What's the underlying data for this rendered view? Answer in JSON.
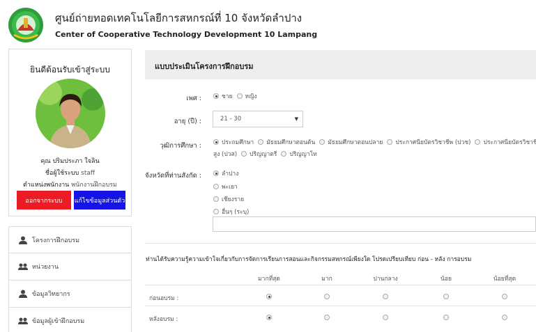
{
  "header": {
    "title_th": "ศูนย์ถ่ายทอดเทคโนโลยีการสหกรณ์ที่ 10 จังหวัดลำปาง",
    "title_en": "Center of Cooperative Technology Development 10 Lampang",
    "logo_icon": "cooperative-logo-icon"
  },
  "profile": {
    "welcome": "ยินดีต้อนรับเข้าสู่ระบบ",
    "name_prefix": "คุณ",
    "name": "ปริมประภา ใจลิน",
    "username_label": "ชื่อผู้ใช้ระบบ",
    "username": "staff",
    "position_label": "ตำแหน่งพนักงาน",
    "position": "พนักงานฝึกอบรม",
    "logout_label": "ออกจากระบบ",
    "edit_label": "แก้ไขข้อมูลส่วนตัว",
    "colors": {
      "logout": "#ed1c24",
      "edit": "#1414e6"
    }
  },
  "menu": {
    "items": [
      {
        "label": "โครงการฝึกอบรม",
        "icon": "user-icon"
      },
      {
        "label": "หน่วยงาน",
        "icon": "group-icon"
      },
      {
        "label": "ข้อมูลวิทยากร",
        "icon": "user-icon"
      },
      {
        "label": "ข้อมูลผู้เข้าฝึกอบรม",
        "icon": "group-icon"
      }
    ]
  },
  "form": {
    "title": "แบบประเมินโครงการฝึกอบรม",
    "gender": {
      "label": "เพศ :",
      "options": [
        "ชาย",
        "หญิง"
      ],
      "selected": "ชาย"
    },
    "age": {
      "label": "อายุ (ปี) :",
      "value": "21 - 30"
    },
    "education": {
      "label": "วุฒิการศึกษา :",
      "options": [
        "ประถมศึกษา",
        "มัธยมศึกษาตอนต้น",
        "มัธยมศึกษาตอนปลาย",
        "ประกาศนียบัตรวิชาชีพ (ปวช)",
        "ประกาศนียบัตรวิชาชีพชั้นสูง (ปวส)",
        "ปริญญาตรี",
        "ปริญญาโท"
      ],
      "line1": [
        "ประถมศึกษา",
        "มัธยมศึกษาตอนต้น",
        "มัธยมศึกษาตอนปลาย",
        "ประกาศนียบัตรวิชาชีพ (ปวช)",
        "ประกาศนียบัตรวิชาชีพชั้น"
      ],
      "line2": [
        "สูง (ปวส)",
        "ปริญญาตรี",
        "ปริญญาโท"
      ],
      "selected": "ประถมศึกษา"
    },
    "province": {
      "label": "จังหวัดที่ท่านสังกัด :",
      "options": [
        "ลำปาง",
        "พะเยา",
        "เชียงราย",
        "อื่นๆ (ระบุ)"
      ],
      "selected": "ลำปาง",
      "other_value": ""
    },
    "knowledge": {
      "question": "ท่านได้รับความรู้ความเข้าใจเกี่ยวกับการจัดการเรียนการสอนและกิจกรรมสหกรณ์เพียงใด โปรดเปรียบเทียบ ก่อน - หลัง การอบรม",
      "columns": [
        "มากที่สุด",
        "มาก",
        "ปานกลาง",
        "น้อย",
        "น้อยที่สุด"
      ],
      "rows": [
        {
          "label": "ก่อนอบรม :",
          "selected": 0
        },
        {
          "label": "หลังอบรม :",
          "selected": 0
        }
      ]
    }
  }
}
